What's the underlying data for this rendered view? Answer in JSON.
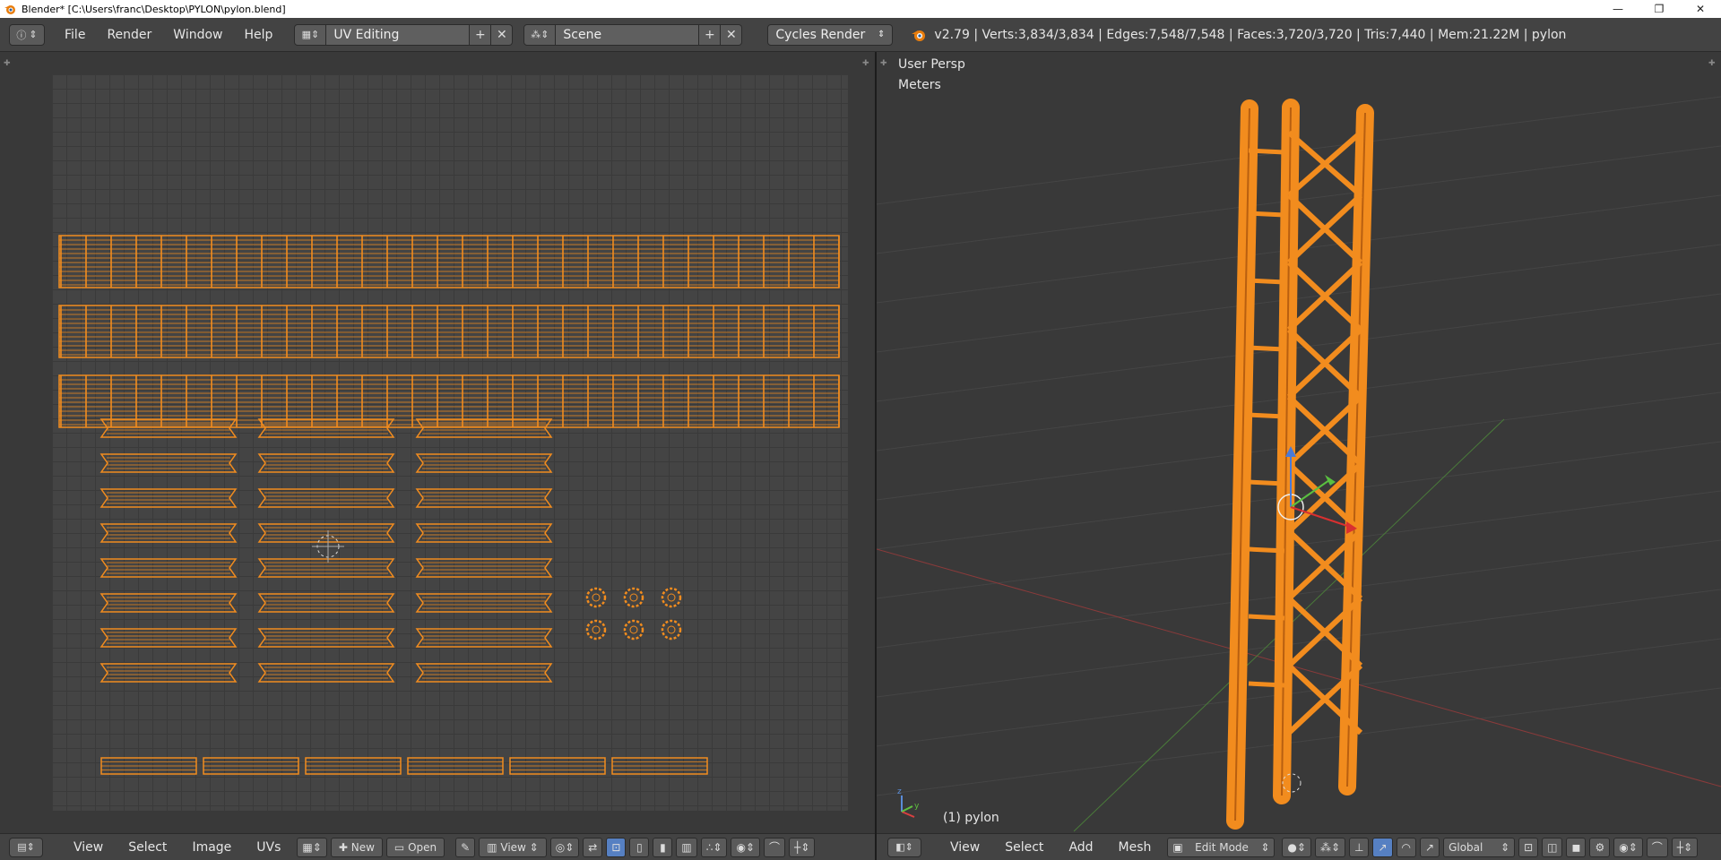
{
  "window": {
    "title": "Blender* [C:\\Users\\franc\\Desktop\\PYLON\\pylon.blend]",
    "minimize": "—",
    "restore": "❐",
    "close": "✕"
  },
  "info_header": {
    "menus": [
      "File",
      "Render",
      "Window",
      "Help"
    ],
    "screen_layout": "UV Editing",
    "scene": "Scene",
    "render_engine": "Cycles Render",
    "stats": "v2.79 | Verts:3,834/3,834 | Edges:7,548/7,548 | Faces:3,720/3,720 | Tris:7,440 | Mem:21.22M | pylon"
  },
  "view3d": {
    "view_name": "User Persp",
    "units": "Meters",
    "object_label": "(1) pylon"
  },
  "uv_footer": {
    "menus": [
      "View",
      "Select",
      "Image",
      "UVs"
    ],
    "new_label": "New",
    "open_label": "Open",
    "view_label": "View"
  },
  "v3d_footer": {
    "menus": [
      "View",
      "Select",
      "Add",
      "Mesh"
    ],
    "mode": "Edit Mode",
    "orientation": "Global"
  },
  "colors": {
    "uv_orange": "#f28c1e",
    "background": "#3d3d3d",
    "grid_red": "#8a3a3a",
    "grid_green": "#4a7a3a"
  }
}
